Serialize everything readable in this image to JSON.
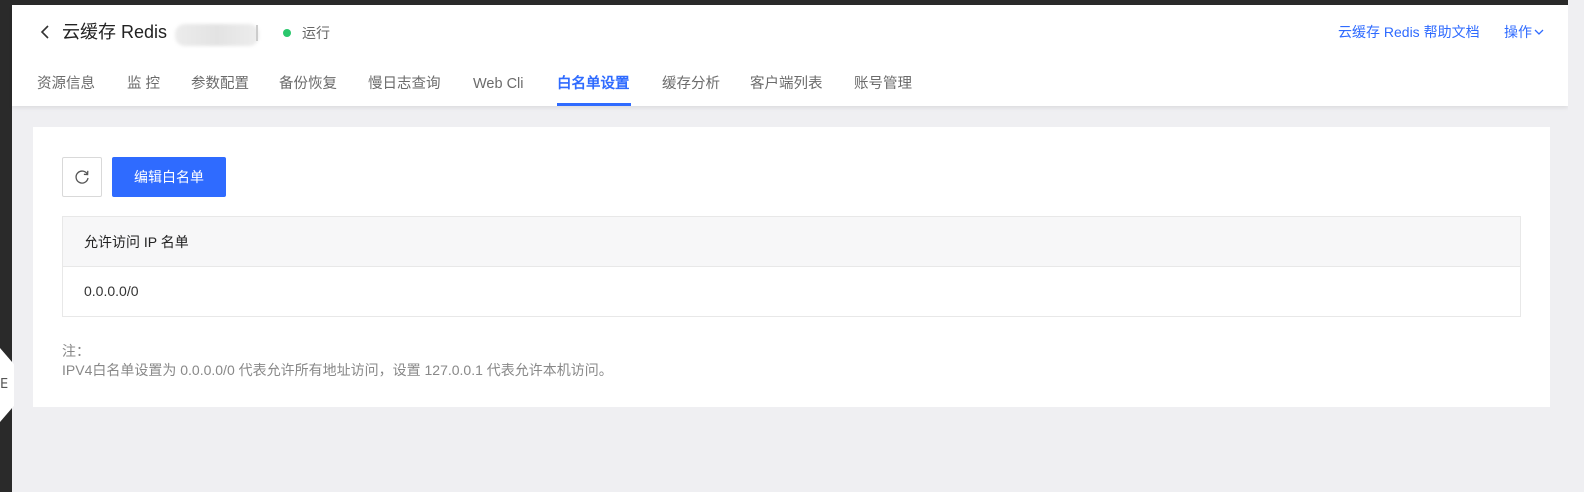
{
  "header": {
    "title": "云缓存 Redis",
    "status": "运行",
    "status_color": "#2ac76c",
    "help_link": "云缓存 Redis 帮助文档",
    "ops_label": "操作"
  },
  "tabs": [
    {
      "label": "资源信息"
    },
    {
      "label": "监 控"
    },
    {
      "label": "参数配置"
    },
    {
      "label": "备份恢复"
    },
    {
      "label": "慢日志查询"
    },
    {
      "label": "Web Cli"
    },
    {
      "label": "白名单设置",
      "active": true
    },
    {
      "label": "缓存分析"
    },
    {
      "label": "客户端列表"
    },
    {
      "label": "账号管理"
    }
  ],
  "toolbar": {
    "refresh_icon": "refresh-icon",
    "edit_label": "编辑白名单"
  },
  "table": {
    "header": "允许访问 IP 名单",
    "rows": [
      "0.0.0.0/0"
    ]
  },
  "note": {
    "label": "注：",
    "text": "IPV4白名单设置为 0.0.0.0/0 代表允许所有地址访问，设置 127.0.0.1 代表允许本机访问。"
  },
  "side_handle_glyph": "E",
  "colors": {
    "accent": "#2f6bff",
    "background": "#efeff2"
  }
}
